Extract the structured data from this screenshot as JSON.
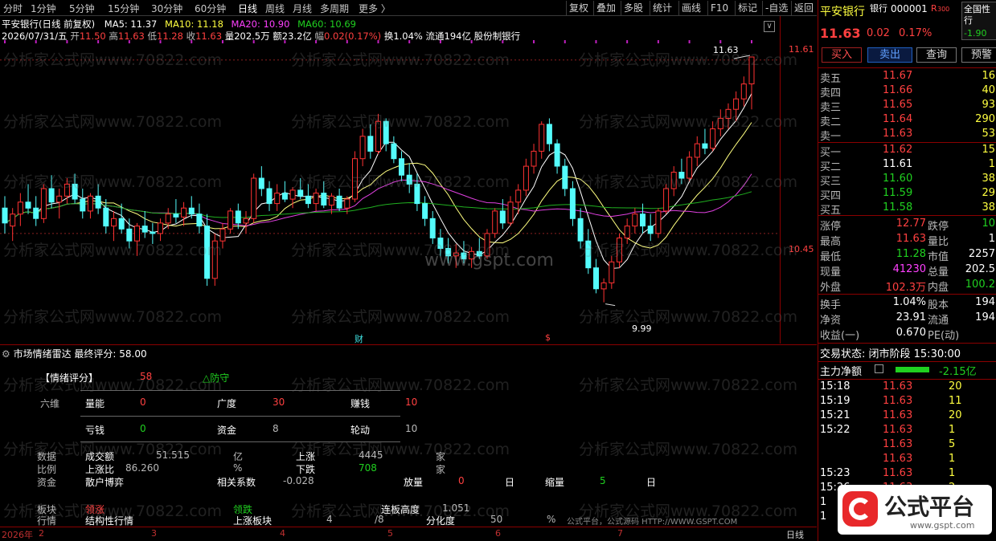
{
  "toolbar": {
    "tabs": [
      "分时",
      "1分钟",
      "5分钟",
      "15分钟",
      "30分钟",
      "60分钟",
      "日线",
      "周线",
      "月线",
      "多周期",
      "更多 〉"
    ],
    "right_buttons": [
      "复权",
      "叠加",
      "多股",
      "统计",
      "画线",
      "F10",
      "标记",
      "-自选",
      "返回"
    ]
  },
  "chart_header": {
    "title": "平安银行(日线 前复权)",
    "ma5": "MA5: 11.37",
    "ma10": "MA10: 11.18",
    "ma20": "MA20: 10.90",
    "ma60": "MA60: 10.69",
    "date": "2026/07/31/五",
    "open_l": "开",
    "open": "11.50",
    "high_l": "高",
    "high": "11.63",
    "low_l": "低",
    "low": "11.28",
    "close_l": "收",
    "close": "11.63",
    "vol": "量202.5万",
    "amount": "额23.2亿",
    "chg_l": "幅",
    "chg": "0.02(0.17%)",
    "turnover": "换1.04%",
    "float": "流通194亿",
    "type": "股份制银行"
  },
  "price_axis": {
    "top": "11.61",
    "mid": "10.45"
  },
  "chart_labels": {
    "max": "11.63",
    "min": "9.99",
    "cai": "财",
    "dollar": "$",
    "watermark_center": "www.gspt.com"
  },
  "chart_data": {
    "type": "candlestick",
    "price_range": [
      9.8,
      11.7
    ],
    "note_high": 11.63,
    "note_low": 9.99,
    "ohlc": [
      [
        10.62,
        10.7,
        10.45,
        10.52
      ],
      [
        10.5,
        10.62,
        10.4,
        10.58
      ],
      [
        10.58,
        10.72,
        10.5,
        10.66
      ],
      [
        10.66,
        10.78,
        10.58,
        10.62
      ],
      [
        10.62,
        10.7,
        10.5,
        10.55
      ],
      [
        10.55,
        10.78,
        10.52,
        10.75
      ],
      [
        10.75,
        10.84,
        10.62,
        10.66
      ],
      [
        10.66,
        10.75,
        10.55,
        10.7
      ],
      [
        10.7,
        10.82,
        10.65,
        10.78
      ],
      [
        10.78,
        10.85,
        10.65,
        10.68
      ],
      [
        10.68,
        10.75,
        10.55,
        10.6
      ],
      [
        10.6,
        10.72,
        10.55,
        10.7
      ],
      [
        10.7,
        10.78,
        10.58,
        10.62
      ],
      [
        10.62,
        10.68,
        10.45,
        10.5
      ],
      [
        10.5,
        10.6,
        10.4,
        10.55
      ],
      [
        10.55,
        10.65,
        10.45,
        10.48
      ],
      [
        10.48,
        10.55,
        10.35,
        10.4
      ],
      [
        10.4,
        10.52,
        10.3,
        10.5
      ],
      [
        10.5,
        10.6,
        10.42,
        10.46
      ],
      [
        10.46,
        10.52,
        10.38,
        10.45
      ],
      [
        10.45,
        10.55,
        10.4,
        10.52
      ],
      [
        10.52,
        10.62,
        10.48,
        10.58
      ],
      [
        10.58,
        10.68,
        10.52,
        10.56
      ],
      [
        10.56,
        10.66,
        10.5,
        10.62
      ],
      [
        10.62,
        10.7,
        10.55,
        10.58
      ],
      [
        10.58,
        10.65,
        10.45,
        10.5
      ],
      [
        10.5,
        10.58,
        10.1,
        10.15
      ],
      [
        10.15,
        10.45,
        10.1,
        10.4
      ],
      [
        10.4,
        10.52,
        10.35,
        10.48
      ],
      [
        10.48,
        10.62,
        10.45,
        10.6
      ],
      [
        10.6,
        10.65,
        10.48,
        10.52
      ],
      [
        10.52,
        10.6,
        10.45,
        10.55
      ],
      [
        10.55,
        10.85,
        10.52,
        10.82
      ],
      [
        10.82,
        10.9,
        10.7,
        10.75
      ],
      [
        10.75,
        10.8,
        10.6,
        10.65
      ],
      [
        10.65,
        10.78,
        10.6,
        10.72
      ],
      [
        10.72,
        10.8,
        10.66,
        10.68
      ],
      [
        10.68,
        10.76,
        10.62,
        10.74
      ],
      [
        10.74,
        10.82,
        10.68,
        10.7
      ],
      [
        10.7,
        10.78,
        10.62,
        10.65
      ],
      [
        10.65,
        10.75,
        10.6,
        10.72
      ],
      [
        10.72,
        10.8,
        10.62,
        10.64
      ],
      [
        10.64,
        10.72,
        10.58,
        10.7
      ],
      [
        10.7,
        10.75,
        10.6,
        10.62
      ],
      [
        10.62,
        10.7,
        10.58,
        10.68
      ],
      [
        10.68,
        11.0,
        10.66,
        10.95
      ],
      [
        10.95,
        11.15,
        10.9,
        11.1
      ],
      [
        11.1,
        11.18,
        10.95,
        11.0
      ],
      [
        11.0,
        11.25,
        10.98,
        11.2
      ],
      [
        11.2,
        11.22,
        11.0,
        11.05
      ],
      [
        11.05,
        11.1,
        10.92,
        10.95
      ],
      [
        10.95,
        11.0,
        10.8,
        10.84
      ],
      [
        10.84,
        10.92,
        10.72,
        10.78
      ],
      [
        10.78,
        10.85,
        10.6,
        10.65
      ],
      [
        10.65,
        10.7,
        10.5,
        10.55
      ],
      [
        10.55,
        10.6,
        10.38,
        10.42
      ],
      [
        10.42,
        10.48,
        10.3,
        10.35
      ],
      [
        10.35,
        10.42,
        10.25,
        10.3
      ],
      [
        10.3,
        10.38,
        10.22,
        10.32
      ],
      [
        10.32,
        10.4,
        10.25,
        10.28
      ],
      [
        10.28,
        10.36,
        10.22,
        10.33
      ],
      [
        10.33,
        10.42,
        10.28,
        10.3
      ],
      [
        10.3,
        10.48,
        10.28,
        10.45
      ],
      [
        10.45,
        10.62,
        10.42,
        10.6
      ],
      [
        10.6,
        10.68,
        10.48,
        10.52
      ],
      [
        10.52,
        10.7,
        10.5,
        10.66
      ],
      [
        10.66,
        10.78,
        10.58,
        10.74
      ],
      [
        10.74,
        10.95,
        10.7,
        10.9
      ],
      [
        10.9,
        11.05,
        10.85,
        11.0
      ],
      [
        11.0,
        11.2,
        10.95,
        11.18
      ],
      [
        11.18,
        11.22,
        11.0,
        11.05
      ],
      [
        11.05,
        11.08,
        10.85,
        10.9
      ],
      [
        10.9,
        10.95,
        10.7,
        10.75
      ],
      [
        10.75,
        10.8,
        10.5,
        10.55
      ],
      [
        10.55,
        10.62,
        10.35,
        10.4
      ],
      [
        10.4,
        10.48,
        10.18,
        10.22
      ],
      [
        10.22,
        10.28,
        10.05,
        10.08
      ],
      [
        10.08,
        10.15,
        9.99,
        10.12
      ],
      [
        10.12,
        10.3,
        10.08,
        10.26
      ],
      [
        10.26,
        10.45,
        10.22,
        10.42
      ],
      [
        10.42,
        10.55,
        10.38,
        10.5
      ],
      [
        10.5,
        10.62,
        10.45,
        10.58
      ],
      [
        10.58,
        10.65,
        10.45,
        10.5
      ],
      [
        10.5,
        10.58,
        10.4,
        10.45
      ],
      [
        10.45,
        10.62,
        10.42,
        10.6
      ],
      [
        10.6,
        10.78,
        10.58,
        10.75
      ],
      [
        10.75,
        10.9,
        10.7,
        10.86
      ],
      [
        10.86,
        10.95,
        10.78,
        10.82
      ],
      [
        10.82,
        11.0,
        10.8,
        10.96
      ],
      [
        10.96,
        11.1,
        10.9,
        11.05
      ],
      [
        11.05,
        11.15,
        10.98,
        11.02
      ],
      [
        11.02,
        11.2,
        11.0,
        11.15
      ],
      [
        11.15,
        11.28,
        11.1,
        11.22
      ],
      [
        11.22,
        11.32,
        11.15,
        11.28
      ],
      [
        11.28,
        11.4,
        11.2,
        11.35
      ],
      [
        11.35,
        11.5,
        11.3,
        11.45
      ],
      [
        11.45,
        11.63,
        11.28,
        11.63
      ]
    ]
  },
  "indicator": {
    "title": "市场情绪雷达  最终评分: 58.00",
    "score_label": "【情绪评分】",
    "score": "58",
    "mood": "△防守",
    "row_six": "六维",
    "liang_neng": "量能",
    "liang_neng_v": "0",
    "guang_du": "广度",
    "guang_du_v": "30",
    "zhuan_qian": "赚钱",
    "zhuan_qian_v": "10",
    "kui_qian": "亏钱",
    "kui_qian_v": "0",
    "zi_jin": "资金",
    "zi_jin_v": "8",
    "lun_dong": "轮动",
    "lun_dong_v": "10",
    "shuju": "数据",
    "cje": "成交额",
    "cje_v": "51.515",
    "yi": "亿",
    "shangzhang": "上涨",
    "shangzhang_v": "4445",
    "jia1": "家",
    "bili": "比例",
    "szb": "上涨比",
    "szb_v": "86.260",
    "pct": "%",
    "xiadie": "下跌",
    "xiadie_v": "708",
    "jia2": "家",
    "zijin": "资金",
    "shbs": "散户博弈",
    "xgxs": "相关系数",
    "xgxs_v": "-0.028",
    "fangliang": "放量",
    "fangliang_v": "0",
    "ri1": "日",
    "suoliang": "缩量",
    "suoliang_v": "5",
    "ri2": "日",
    "bankuai": "板块",
    "lingzhang": "领涨",
    "lingdie": "领跌",
    "lbgd": "连板高度",
    "lbgd_v": "1.051",
    "hangqing": "行情",
    "jgxhq": "结构性行情",
    "szbk": "上涨板块",
    "szbk_v": "4",
    "szbk_total": "/8",
    "fhd": "分化度",
    "fhd_v": "50",
    "pct2": "%",
    "footer": "公式平台，公式源码 HTTP://WWW.GSPT.COM"
  },
  "timeaxis": {
    "year": "2026年",
    "m2": "2",
    "m3": "3",
    "m4": "4",
    "m5": "5",
    "m6": "6",
    "m7": "7",
    "period": "日线"
  },
  "quote": {
    "name": "平安银行",
    "name_tag": "银行",
    "code": "000001",
    "r": "R",
    "r300": "300",
    "price": "11.63",
    "chg": "0.02",
    "pct": "0.17%",
    "sector": "全国性行",
    "sector_chg": "-1.90",
    "buttons": [
      "买入",
      "卖出",
      "查询",
      "预警"
    ],
    "asks": [
      [
        "卖五",
        "11.67",
        "16"
      ],
      [
        "卖四",
        "11.66",
        "40"
      ],
      [
        "卖三",
        "11.65",
        "93"
      ],
      [
        "卖二",
        "11.64",
        "290"
      ],
      [
        "卖一",
        "11.63",
        "53"
      ]
    ],
    "bids": [
      [
        "买一",
        "11.62",
        "15"
      ],
      [
        "买二",
        "11.61",
        "1"
      ],
      [
        "买三",
        "11.60",
        "38"
      ],
      [
        "买四",
        "11.59",
        "29"
      ],
      [
        "买五",
        "11.58",
        "38"
      ]
    ],
    "stats": [
      [
        "涨停",
        "12.77",
        "跌停",
        "10"
      ],
      [
        "最高",
        "11.63",
        "量比",
        "1"
      ],
      [
        "最低",
        "11.28",
        "市值",
        "2257"
      ],
      [
        "现量",
        "41230",
        "总量",
        "202.5"
      ],
      [
        "外盘",
        "102.3万",
        "内盘",
        "100.2"
      ]
    ],
    "stats2": [
      [
        "换手",
        "1.04%",
        "股本",
        "194"
      ],
      [
        "净资",
        "23.91",
        "流通",
        "194"
      ],
      [
        "收益(一)",
        "0.670",
        "PE(动)",
        ""
      ]
    ],
    "trade_status": "交易状态: 闭市阶段 15:30:00",
    "main_flow_label": "主力净额",
    "main_flow": "-2.15亿",
    "ticks": [
      [
        "15:18",
        "11.63",
        "20"
      ],
      [
        "15:19",
        "11.63",
        "11"
      ],
      [
        "15:21",
        "11.63",
        "20"
      ],
      [
        "15:22",
        "11.63",
        "1"
      ],
      [
        "",
        "11.63",
        "5"
      ],
      [
        "",
        "11.63",
        "1"
      ],
      [
        "15:23",
        "11.63",
        "1"
      ],
      [
        "15:26",
        "11.63",
        "2"
      ],
      [
        "1",
        "",
        ""
      ],
      [
        "1",
        "",
        ""
      ]
    ]
  },
  "logo": {
    "text": "公式平台",
    "url": "www.gspt.com"
  },
  "watermark": "分析家公式网www.70822.com"
}
